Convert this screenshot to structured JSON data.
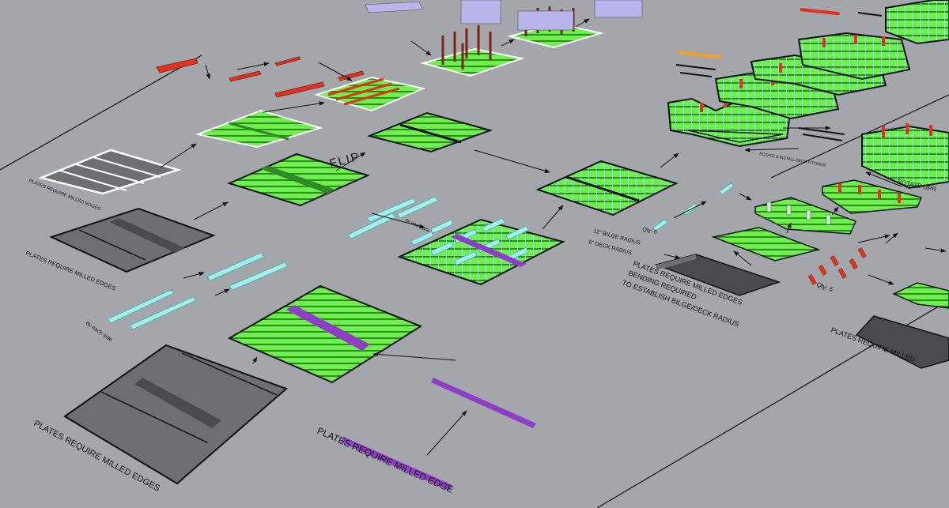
{
  "labels": {
    "milled_front": "PLATES REQUIRE MILLED EDGES",
    "milled_mid": "PLATES REQUIRE MILLED EDGES",
    "milled_bottom": "PLATES REQUIRE MILLED EDGE",
    "milled_right": "PLATES REQUIRE MILLED",
    "plates_use_note": "PLATES REQUIRE MILLED EDGES",
    "six_each_side_a": "6x each side",
    "six_each_side_b": "6x each side",
    "flip": "FLIP",
    "bilge_radius": "12\" BILGE RADIUS",
    "deck_radius": "6\" DECK RADIUS",
    "bending_line1": "PLATES REQUIRE MILLED EDGES",
    "bending_line2": "BENDING REQUIRED",
    "bending_line3": "TO ESTABLISH BILGE/DECK RADIUS",
    "qty_a": "Qty: 6",
    "qty_b": "Qty: 6",
    "rotate": "ROTATE UPR",
    "colors_note": "ROTATE & INSTALL DECK FITTINGS"
  },
  "colors": {
    "background": "#a3a6aa",
    "frame_green": "#6df04a",
    "stripe_dark_green": "#2f8a25",
    "plate_gray": "#6e6f72",
    "plate_dark": "#4a4b4e",
    "rib_cyan": "#9ff1ee",
    "keel_purple": "#8f3cc6",
    "fitting_red": "#e2311d",
    "rod_brown": "#7a2413",
    "outline_white": "#ffffff",
    "arrow_black": "#111111"
  }
}
